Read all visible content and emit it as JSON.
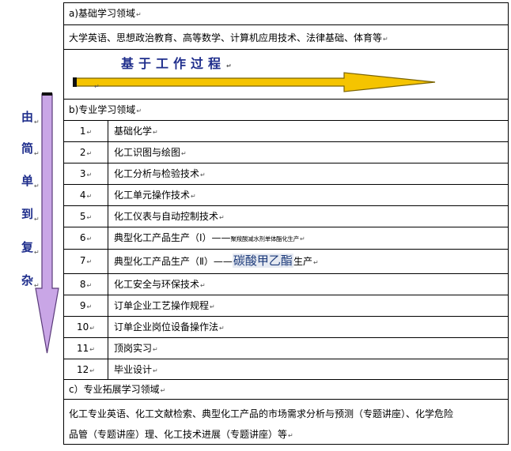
{
  "section_a": {
    "heading": "a)基础学习领域",
    "courses": "大学英语、思想政治教育、高等数学、计算机应用技术、法律基础、体育等"
  },
  "process": {
    "title": "基于工作过程",
    "arrow_fill": "#f5c400",
    "arrow_stroke": "#7a6300"
  },
  "progression": {
    "chars": [
      "由",
      "简",
      "单",
      "到",
      "复",
      "杂"
    ],
    "arrow_fill": "#c9a6e6",
    "arrow_stroke": "#5a3a7a"
  },
  "section_b": {
    "heading": "b)专业学习领域",
    "courses": [
      {
        "no": "1",
        "name": "基础化学"
      },
      {
        "no": "2",
        "name": "化工识图与绘图"
      },
      {
        "no": "3",
        "name": "化工分析与检验技术"
      },
      {
        "no": "4",
        "name": "化工单元操作技术"
      },
      {
        "no": "5",
        "name": "化工仪表与自动控制技术"
      },
      {
        "no": "6",
        "name": "典型化工产品生产（Ⅰ）——",
        "note": "聚羧酸减水剂单体酯化生产"
      },
      {
        "no": "7",
        "name": "典型化工产品生产（Ⅱ）——",
        "highlight": "碳酸甲乙酯",
        "suffix": "生产"
      },
      {
        "no": "8",
        "name": "化工安全与环保技术"
      },
      {
        "no": "9",
        "name": "订单企业工艺操作规程"
      },
      {
        "no": "10",
        "name": "订单企业岗位设备操作法"
      },
      {
        "no": "11",
        "name": "顶岗实习"
      },
      {
        "no": "12",
        "name": "毕业设计"
      }
    ]
  },
  "section_c": {
    "heading": "c）专业拓展学习领域",
    "line1": "化工专业英语、化工文献检索、典型化工产品的市场需求分析与预测（专题讲座）、化学危险",
    "line2": "品管（专题讲座）理、化工技术进展（专题讲座）等"
  },
  "paragraph_mark": "↵"
}
